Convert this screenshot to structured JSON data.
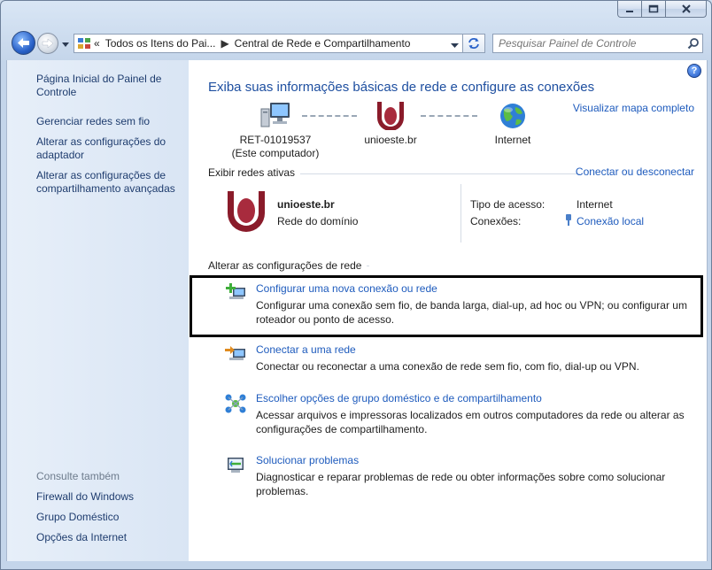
{
  "window": {
    "minimize": "minimize-icon",
    "maximize": "maximize-icon",
    "close": "close-icon"
  },
  "address_bar": {
    "prefix": "«",
    "crumbs": [
      "Todos os Itens do Pai...",
      "Central de Rede e Compartilhamento"
    ]
  },
  "search": {
    "placeholder": "Pesquisar Painel de Controle"
  },
  "sidebar": {
    "links": [
      "Página Inicial do Painel de Controle",
      "Gerenciar redes sem fio",
      "Alterar as configurações do adaptador",
      "Alterar as configurações de compartilhamento avançadas"
    ],
    "see_also_heading": "Consulte também",
    "see_also": [
      "Firewall do Windows",
      "Grupo Doméstico",
      "Opções da Internet"
    ]
  },
  "main": {
    "title": "Exiba suas informações básicas de rede e configure as conexões",
    "map_link": "Visualizar mapa completo",
    "nodes": {
      "computer": "RET-01019537",
      "computer_sub": "(Este computador)",
      "network": "unioeste.br",
      "internet": "Internet"
    },
    "active_networks_label": "Exibir redes ativas",
    "connect_link": "Conectar ou desconectar",
    "active_network": {
      "name": "unioeste.br",
      "type": "Rede do domínio",
      "access_label": "Tipo de acesso:",
      "access_value": "Internet",
      "connections_label": "Conexões:",
      "connections_value": "Conexão local"
    },
    "change_settings_label": "Alterar as configurações de rede",
    "tasks": [
      {
        "title": "Configurar uma nova conexão ou rede",
        "desc": "Configurar uma conexão sem fio, de banda larga, dial-up, ad hoc ou VPN; ou configurar um roteador ou ponto de acesso."
      },
      {
        "title": "Conectar a uma rede",
        "desc": "Conectar ou reconectar a uma conexão de rede sem fio, com fio, dial-up ou VPN."
      },
      {
        "title": "Escolher opções de grupo doméstico e de compartilhamento",
        "desc": "Acessar arquivos e impressoras localizados em outros computadores da rede ou alterar as configurações de compartilhamento."
      },
      {
        "title": "Solucionar problemas",
        "desc": "Diagnosticar e reparar problemas de rede ou obter informações sobre como solucionar problemas."
      }
    ]
  },
  "colors": {
    "link": "#1e5bbd",
    "title": "#1e4fa0",
    "sidebar_bg": "#e7eff9",
    "highlight_border": "#000000"
  }
}
